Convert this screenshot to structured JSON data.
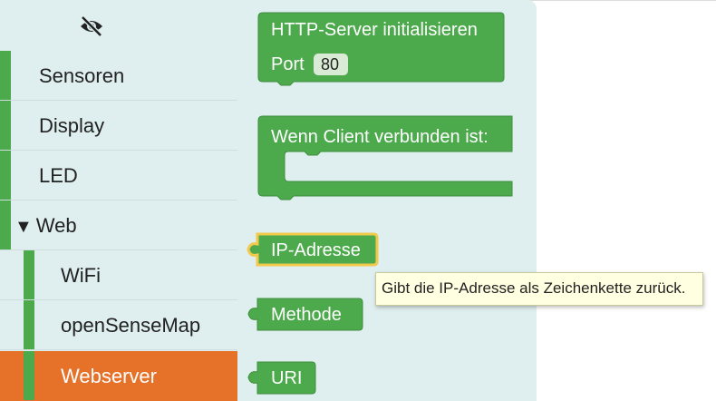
{
  "toolbox": {
    "hide_icon": "eye-off-icon",
    "categories": [
      {
        "label": "Sensoren"
      },
      {
        "label": "Display"
      },
      {
        "label": "LED"
      },
      {
        "label": "Web",
        "arrow": "▼"
      }
    ],
    "subcategories": [
      {
        "label": "WiFi"
      },
      {
        "label": "openSenseMap"
      },
      {
        "label": "Webserver"
      }
    ]
  },
  "blocks": {
    "http_server": {
      "line1": "HTTP-Server initialisieren",
      "port_label": "Port",
      "port_value": "80"
    },
    "client_connected": {
      "label": "Wenn Client verbunden ist:"
    },
    "ip_address": {
      "label": "IP-Adresse"
    },
    "method": {
      "label": "Methode"
    },
    "uri": {
      "label": "URI"
    }
  },
  "tooltip": {
    "text": "Gibt die IP-Adresse als Zeichenkette zurück."
  },
  "colors": {
    "block_green": "#4caa4c",
    "selected": "#e6722a",
    "highlight": "#f2c94c",
    "toolbox_bg": "#dfeeee"
  }
}
